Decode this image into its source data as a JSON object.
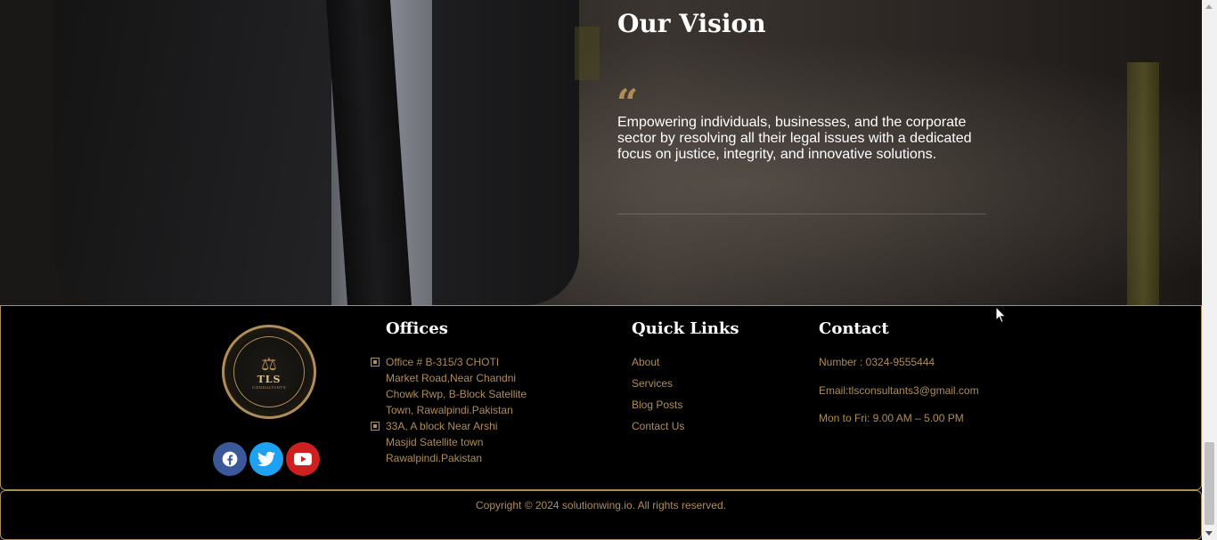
{
  "vision": {
    "title": "Our Vision",
    "quote_icon": "quote-left-icon",
    "text": "Empowering individuals, businesses, and the corporate sector by resolving all their legal issues with a dedicated focus on justice, integrity, and innovative solutions."
  },
  "footer": {
    "logo": {
      "name": "TLS",
      "subtitle": "CONSULTANTS"
    },
    "social": [
      {
        "name": "facebook-icon"
      },
      {
        "name": "twitter-icon"
      },
      {
        "name": "youtube-icon"
      }
    ],
    "offices": {
      "title": "Offices",
      "items": [
        "Office # B-315/3 CHOTI Market Road,Near Chandni Chowk Rwp, B-Block Satellite Town, Rawalpindi.Pakistan",
        "33A, A block Near Arshi Masjid Satellite town Rawalpindi.Pakistan"
      ]
    },
    "quick_links": {
      "title": "Quick Links",
      "items": [
        "About",
        "Services",
        "Blog Posts",
        "Contact Us"
      ]
    },
    "contact": {
      "title": "Contact",
      "number": "Number : 0324-9555444",
      "email": "Email:tlsconsultants3@gmail.com",
      "hours": "Mon to Fri: 9.00 AM – 5.00 PM"
    },
    "copyright": "Copyright © 2024 solutionwing.io. All rights reserved."
  },
  "colors": {
    "accent": "#b08d57",
    "facebook": "#3b5998",
    "twitter": "#1da1f2",
    "youtube": "#cd201f"
  }
}
